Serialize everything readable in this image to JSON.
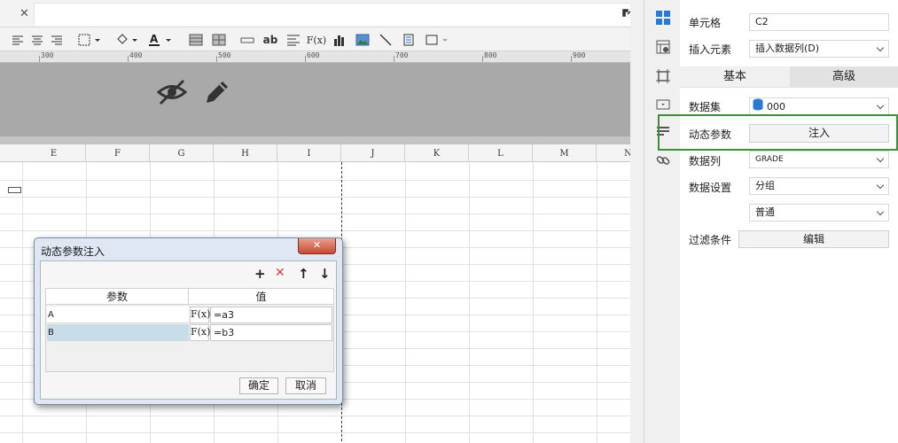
{
  "tabbar": {
    "close_glyph": "✕"
  },
  "ruler": {
    "labels": [
      "300",
      "400",
      "500",
      "600",
      "700",
      "800",
      "900"
    ]
  },
  "columns": [
    "E",
    "F",
    "G",
    "H",
    "I",
    "J",
    "K",
    "L",
    "M",
    "N"
  ],
  "panel": {
    "cell_label": "单元格",
    "cell_value": "C2",
    "insert_label": "插入元素",
    "insert_value": "插入数据列(D)",
    "tab_basic": "基本",
    "tab_advanced": "高级",
    "dataset_label": "数据集",
    "dataset_value": "000",
    "dynamic_param_label": "动态参数",
    "inject_button": "注入",
    "data_column_label": "数据列",
    "data_column_value": "GRADE",
    "data_setting_label": "数据设置",
    "data_setting_value": "分组",
    "data_setting_mode": "普通",
    "filter_label": "过滤条件",
    "edit_button": "编辑"
  },
  "dialog": {
    "title": "动态参数注入",
    "close_glyph": "✕",
    "toolbar": {
      "add": "+",
      "delete": "✕",
      "up": "↑",
      "down": "↓"
    },
    "headers": {
      "param": "参数",
      "value": "值"
    },
    "rows": [
      {
        "param": "A",
        "fx": "F(x)",
        "value": "=a3"
      },
      {
        "param": "B",
        "fx": "F(x)",
        "value": "=b3"
      }
    ],
    "ok": "确定",
    "cancel": "取消"
  },
  "colors": {
    "accent_blue": "#2a7ad5",
    "highlight_green": "#3c8f3c",
    "delete_red": "#e23b3b",
    "selected_row": "#c9dcea"
  }
}
